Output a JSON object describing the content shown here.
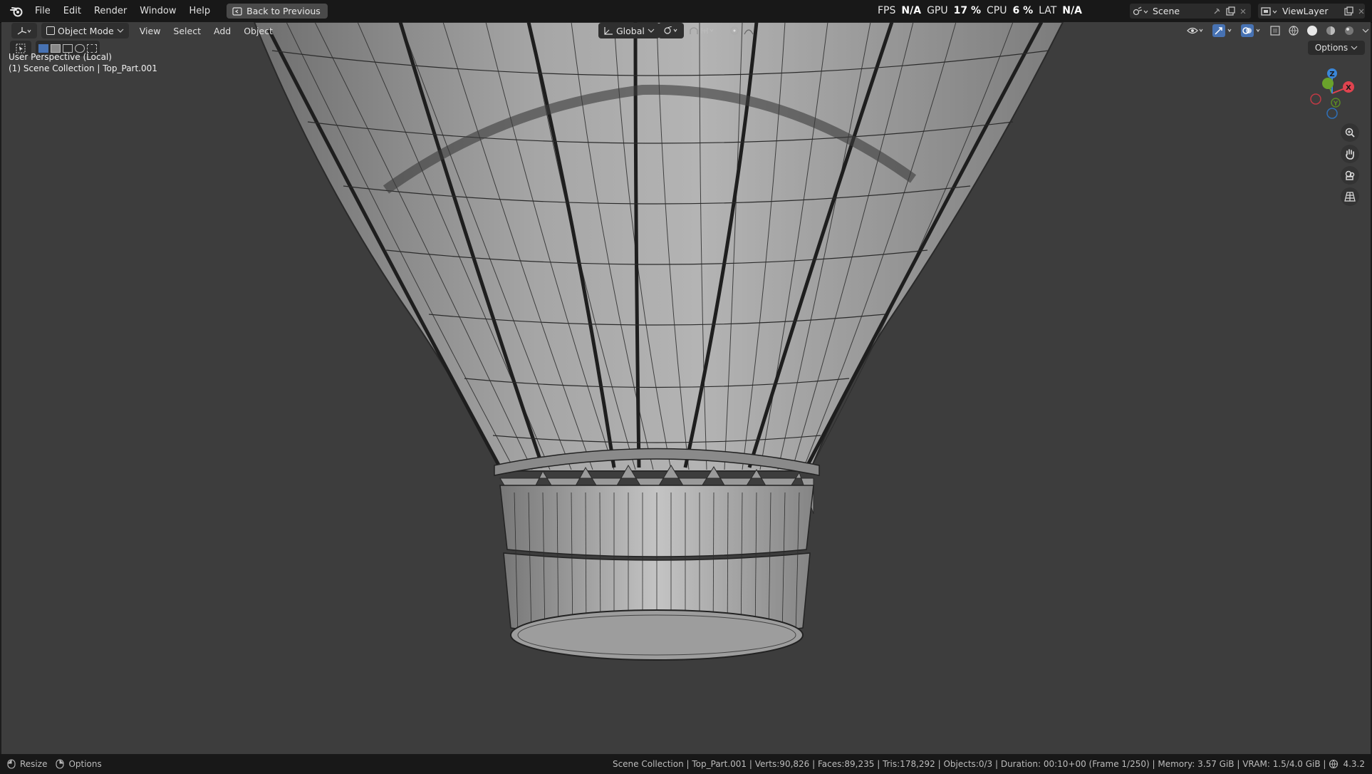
{
  "menubar": {
    "items": [
      "File",
      "Edit",
      "Render",
      "Window",
      "Help"
    ],
    "back_button": "Back to Previous"
  },
  "performance": {
    "fps_label": "FPS",
    "fps_value": "N/A",
    "gpu_label": "GPU",
    "gpu_value": "17 %",
    "cpu_label": "CPU",
    "cpu_value": "6 %",
    "lat_label": "LAT",
    "lat_value": "N/A"
  },
  "scene": {
    "name": "Scene"
  },
  "view_layer": {
    "name": "ViewLayer"
  },
  "viewport_header": {
    "mode": "Object Mode",
    "menus": [
      "View",
      "Select",
      "Add",
      "Object"
    ],
    "orientation": "Global",
    "options_label": "Options"
  },
  "overlay": {
    "view_name": "User Perspective (Local)",
    "collection_path": "(1) Scene Collection | Top_Part.001"
  },
  "gizmo": {
    "x": "X",
    "y": "Y",
    "z": "Z"
  },
  "statusbar": {
    "resize": "Resize",
    "options": "Options",
    "stats": "Scene Collection | Top_Part.001 | Verts:90,826 | Faces:89,235 | Tris:178,292 | Objects:0/3 | Duration: 00:10+00 (Frame 1/250) | Memory: 3.57 GiB | VRAM: 1.5/4.0 GiB |",
    "version": "4.3.2"
  },
  "colors": {
    "viewport_bg": "#3d3d3d",
    "axis_x": "#e0434f",
    "axis_y": "#6aa32b",
    "axis_z": "#3a87d9"
  }
}
